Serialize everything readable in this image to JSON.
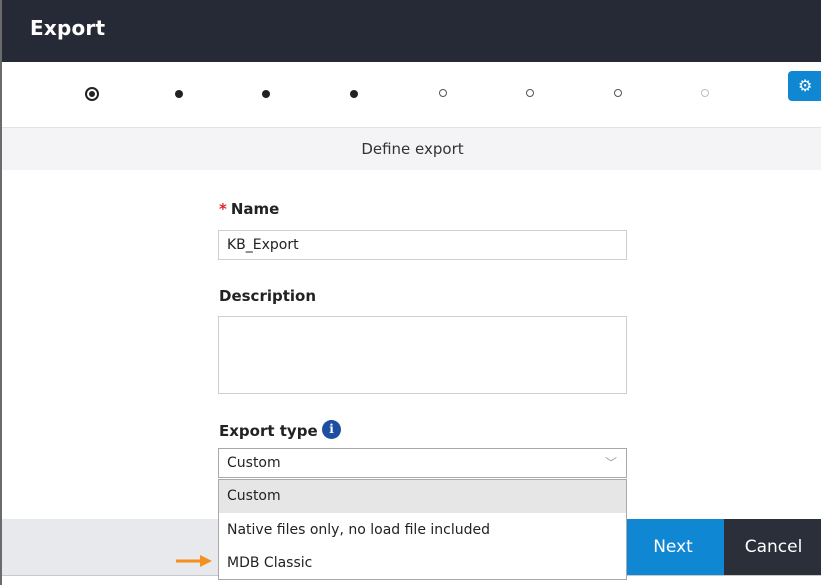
{
  "window": {
    "title": "Export"
  },
  "stepper": {
    "steps": [
      {
        "state": "current"
      },
      {
        "state": "done"
      },
      {
        "state": "done"
      },
      {
        "state": "done"
      },
      {
        "state": "todo"
      },
      {
        "state": "todo"
      },
      {
        "state": "todo"
      },
      {
        "state": "disabled"
      }
    ],
    "settings_icon": "gear-icon"
  },
  "step_title": "Define export",
  "form": {
    "name": {
      "required_marker": "*",
      "label": "Name",
      "value": "KB_Export"
    },
    "description": {
      "label": "Description",
      "value": ""
    },
    "export_type": {
      "label": "Export type",
      "info_icon": "info-icon",
      "selected": "Custom",
      "options": [
        "Custom",
        "Native files only, no load file included",
        "MDB Classic"
      ]
    }
  },
  "footer": {
    "next_label": "Next",
    "cancel_label": "Cancel"
  },
  "colors": {
    "titlebar": "#262a36",
    "accent": "#0f87d3",
    "required": "#d9272d",
    "pointer_arrow": "#f5901e"
  }
}
